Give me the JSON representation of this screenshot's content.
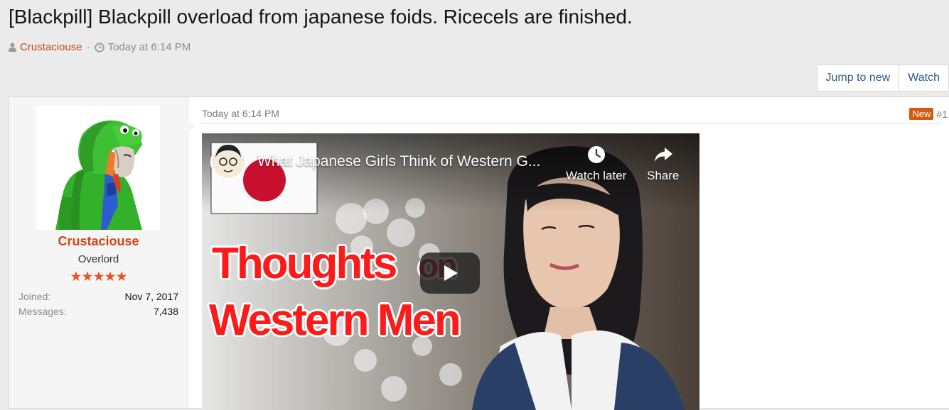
{
  "thread": {
    "title": "[Blackpill] Blackpill overload from japanese foids. Ricecels are finished.",
    "author": "Crustaciouse",
    "separator": "·",
    "date": "Today at 6:14 PM"
  },
  "actions": {
    "jump_to_new": "Jump to new",
    "watch": "Watch"
  },
  "user": {
    "name": "Crustaciouse",
    "title": "Overlord",
    "stars": "★★★★★",
    "joined_label": "Joined:",
    "joined_value": "Nov 7, 2017",
    "messages_label": "Messages:",
    "messages_value": "7,438"
  },
  "message": {
    "date": "Today at 6:14 PM",
    "new_badge": "New",
    "post_number": "#1"
  },
  "video": {
    "title": "What Japanese Girls Think of Western G...",
    "watch_later": "Watch later",
    "share": "Share",
    "overlay_line1": "Thoughts",
    "overlay_on": "on",
    "overlay_line2": "Western Men"
  },
  "colors": {
    "author": "#c84614",
    "username": "#d4441a",
    "link": "#2b5a8c",
    "new_badge": "#d45a0e"
  }
}
